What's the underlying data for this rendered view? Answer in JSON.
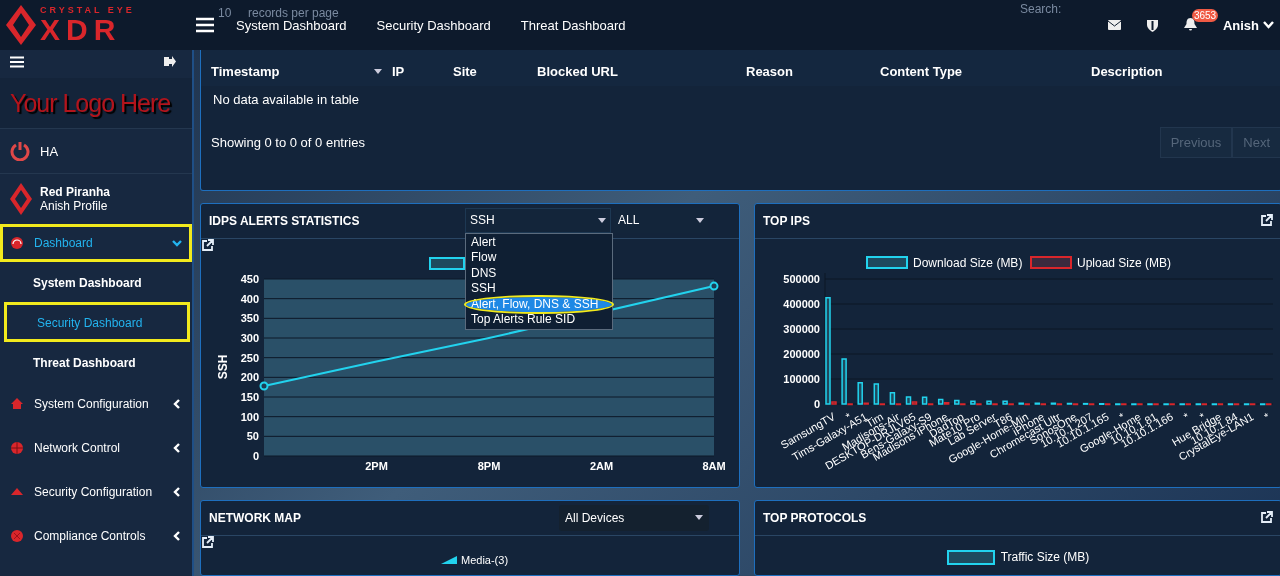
{
  "topbar": {
    "brand_top": "CRYSTAL EYE",
    "brand_main": "XDR",
    "nav_links": [
      "System Dashboard",
      "Security Dashboard",
      "Threat Dashboard"
    ],
    "records_value": "10",
    "records_label": "records per page",
    "search_label": "Search:",
    "notification_count": "3653",
    "user": "Anish"
  },
  "sidebar": {
    "logo_text": "Your Logo Here",
    "ha_label": "HA",
    "profile_name": "Red Piranha",
    "profile_subtitle": "Anish Profile",
    "nav": [
      {
        "label": "Dashboard",
        "selected": true,
        "expanded": true,
        "highlighted": true,
        "children": [
          {
            "label": "System Dashboard",
            "selected": false,
            "highlighted": false
          },
          {
            "label": "Security Dashboard",
            "selected": true,
            "highlighted": true
          },
          {
            "label": "Threat Dashboard",
            "selected": false,
            "highlighted": false
          }
        ]
      },
      {
        "label": "System Configuration",
        "selected": false,
        "expanded": false,
        "highlighted": false
      },
      {
        "label": "Network Control",
        "selected": false,
        "expanded": false,
        "highlighted": false
      },
      {
        "label": "Security Configuration",
        "selected": false,
        "expanded": false,
        "highlighted": false
      },
      {
        "label": "Compliance Controls",
        "selected": false,
        "expanded": false,
        "highlighted": false
      }
    ]
  },
  "blocked_table": {
    "columns": [
      {
        "label": "Timestamp",
        "sorted": true
      },
      {
        "label": "IP",
        "sorted": false
      },
      {
        "label": "Site",
        "sorted": false
      },
      {
        "label": "Blocked URL",
        "sorted": false
      },
      {
        "label": "Reason",
        "sorted": false
      },
      {
        "label": "Content Type",
        "sorted": false
      },
      {
        "label": "Description",
        "sorted": false
      }
    ],
    "empty_message": "No data available in table",
    "info": "Showing 0 to 0 of 0 entries",
    "pager": [
      {
        "label": "Previous",
        "disabled": true
      },
      {
        "label": "Next",
        "disabled": true
      }
    ]
  },
  "idps_alerts": {
    "title": "IDPS ALERTS STATISTICS",
    "metric_select": "SSH",
    "scope_select": "ALL",
    "metric_options": [
      {
        "label": "Alert",
        "selected": false,
        "annotated": false
      },
      {
        "label": "Flow",
        "selected": false,
        "annotated": false
      },
      {
        "label": "DNS",
        "selected": false,
        "annotated": false
      },
      {
        "label": "SSH",
        "selected": false,
        "annotated": false
      },
      {
        "label": "Alert, Flow, DNS & SSH",
        "selected": true,
        "annotated": true
      },
      {
        "label": "Top Alerts Rule SID",
        "selected": false,
        "annotated": false
      }
    ],
    "chart_data": {
      "type": "line",
      "grid": true,
      "ylabel": "SSH",
      "categories": [
        null,
        "2PM",
        "8PM",
        "2AM",
        "8AM"
      ],
      "series": [
        {
          "color": "#22d3ee",
          "values": [
            178,
            240,
            300,
            null,
            432
          ]
        }
      ],
      "ylim": [
        0,
        450
      ],
      "yticks": [
        0,
        50,
        100,
        150,
        200,
        250,
        300,
        350,
        400,
        450
      ]
    }
  },
  "top_ips": {
    "title": "TOP IPS",
    "chart_data": {
      "type": "bar",
      "grid": true,
      "legend": true,
      "categories": [
        "SamsungTV",
        "*",
        "Tims-Galaxy-A51",
        "Tim",
        "Madisons-Air",
        "DESKTOP-DRJLV65",
        "Bens-Galaxy-S9",
        "Madisons iPhone",
        "DadTop",
        "Mate10 Pro",
        "Lab Server",
        "T86",
        "Google-Home-Min",
        "iPhone",
        "Chromecast Ultr",
        "SonosOne",
        "10.10.1.207",
        "10.10.1.165",
        "*",
        "Google-Home",
        "10.10.1.81",
        "10.10.1.166",
        "*",
        "*",
        "Hue Bridge",
        "10.10.1.84",
        "CrystalEye-LAN1",
        "*"
      ],
      "series": [
        {
          "name": "Download Size (MB)",
          "color": "#22d3ee",
          "values": [
            425000,
            180000,
            85000,
            80000,
            45000,
            28000,
            27000,
            18000,
            14000,
            11000,
            11000,
            11000,
            3000,
            3000,
            3000,
            2000,
            1500,
            1000,
            0,
            0,
            0,
            0,
            0,
            0,
            0,
            0,
            0,
            0
          ]
        },
        {
          "name": "Upload Size (MB)",
          "color": "#d9262b",
          "values": [
            8000,
            0,
            3000,
            0,
            0,
            8000,
            0,
            5000,
            0,
            0,
            0,
            0,
            0,
            0,
            0,
            0,
            0,
            0,
            0,
            0,
            0,
            0,
            0,
            0,
            0,
            0,
            0,
            0
          ]
        }
      ],
      "ylim": [
        0,
        500000
      ],
      "yticks": [
        0,
        100000,
        200000,
        300000,
        400000,
        500000
      ]
    }
  },
  "network_map": {
    "title": "NETWORK MAP",
    "device_select": "All Devices",
    "node_label": "Media-(3)"
  },
  "top_protocols": {
    "title": "TOP PROTOCOLS",
    "legend": "Traffic Size (MB)"
  }
}
